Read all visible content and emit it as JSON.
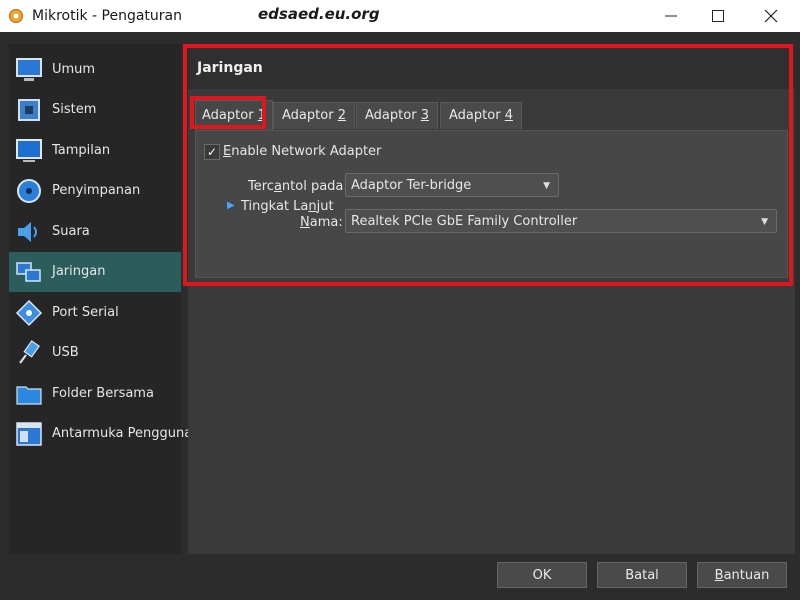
{
  "window": {
    "title": "Mikrotik - Pengaturan",
    "watermark": "edsaed.eu.org"
  },
  "sidebar": {
    "items": [
      {
        "label": "Umum",
        "icon": "monitor-icon"
      },
      {
        "label": "Sistem",
        "icon": "chip-icon"
      },
      {
        "label": "Tampilan",
        "icon": "display-icon"
      },
      {
        "label": "Penyimpanan",
        "icon": "disk-icon"
      },
      {
        "label": "Suara",
        "icon": "speaker-icon"
      },
      {
        "label": "Jaringan",
        "icon": "network-icon",
        "active": true
      },
      {
        "label": "Port Serial",
        "icon": "serial-port-icon"
      },
      {
        "label": "USB",
        "icon": "usb-icon"
      },
      {
        "label": "Folder Bersama",
        "icon": "folder-icon"
      },
      {
        "label": "Antarmuka Pengguna",
        "icon": "window-icon"
      }
    ]
  },
  "panel": {
    "title": "Jaringan",
    "tabs": [
      {
        "label_pre": "Adaptor ",
        "label_key": "1"
      },
      {
        "label_pre": "Adaptor ",
        "label_key": "2"
      },
      {
        "label_pre": "Adaptor ",
        "label_key": "3"
      },
      {
        "label_pre": "Adaptor ",
        "label_key": "4"
      }
    ],
    "enable": {
      "checked_mark": "✓",
      "label_key": "E",
      "label_rest": "nable Network Adapter"
    },
    "attached": {
      "label_pre": "Terc",
      "label_key": "a",
      "label_post": "ntol pada:",
      "value": "Adaptor Ter-bridge"
    },
    "name": {
      "label_key": "N",
      "label_post": "ama:",
      "value": "Realtek PCIe GbE Family Controller"
    },
    "advanced": {
      "label_pre": "Tingkat La",
      "label_key": "n",
      "label_post": "jut"
    }
  },
  "footer": {
    "ok": "OK",
    "cancel": "Batal",
    "help_key": "B",
    "help_rest": "antuan"
  },
  "colors": {
    "highlight": "#e0161f",
    "active_item": "#2a5d5b",
    "expander": "#4aa3ff"
  }
}
